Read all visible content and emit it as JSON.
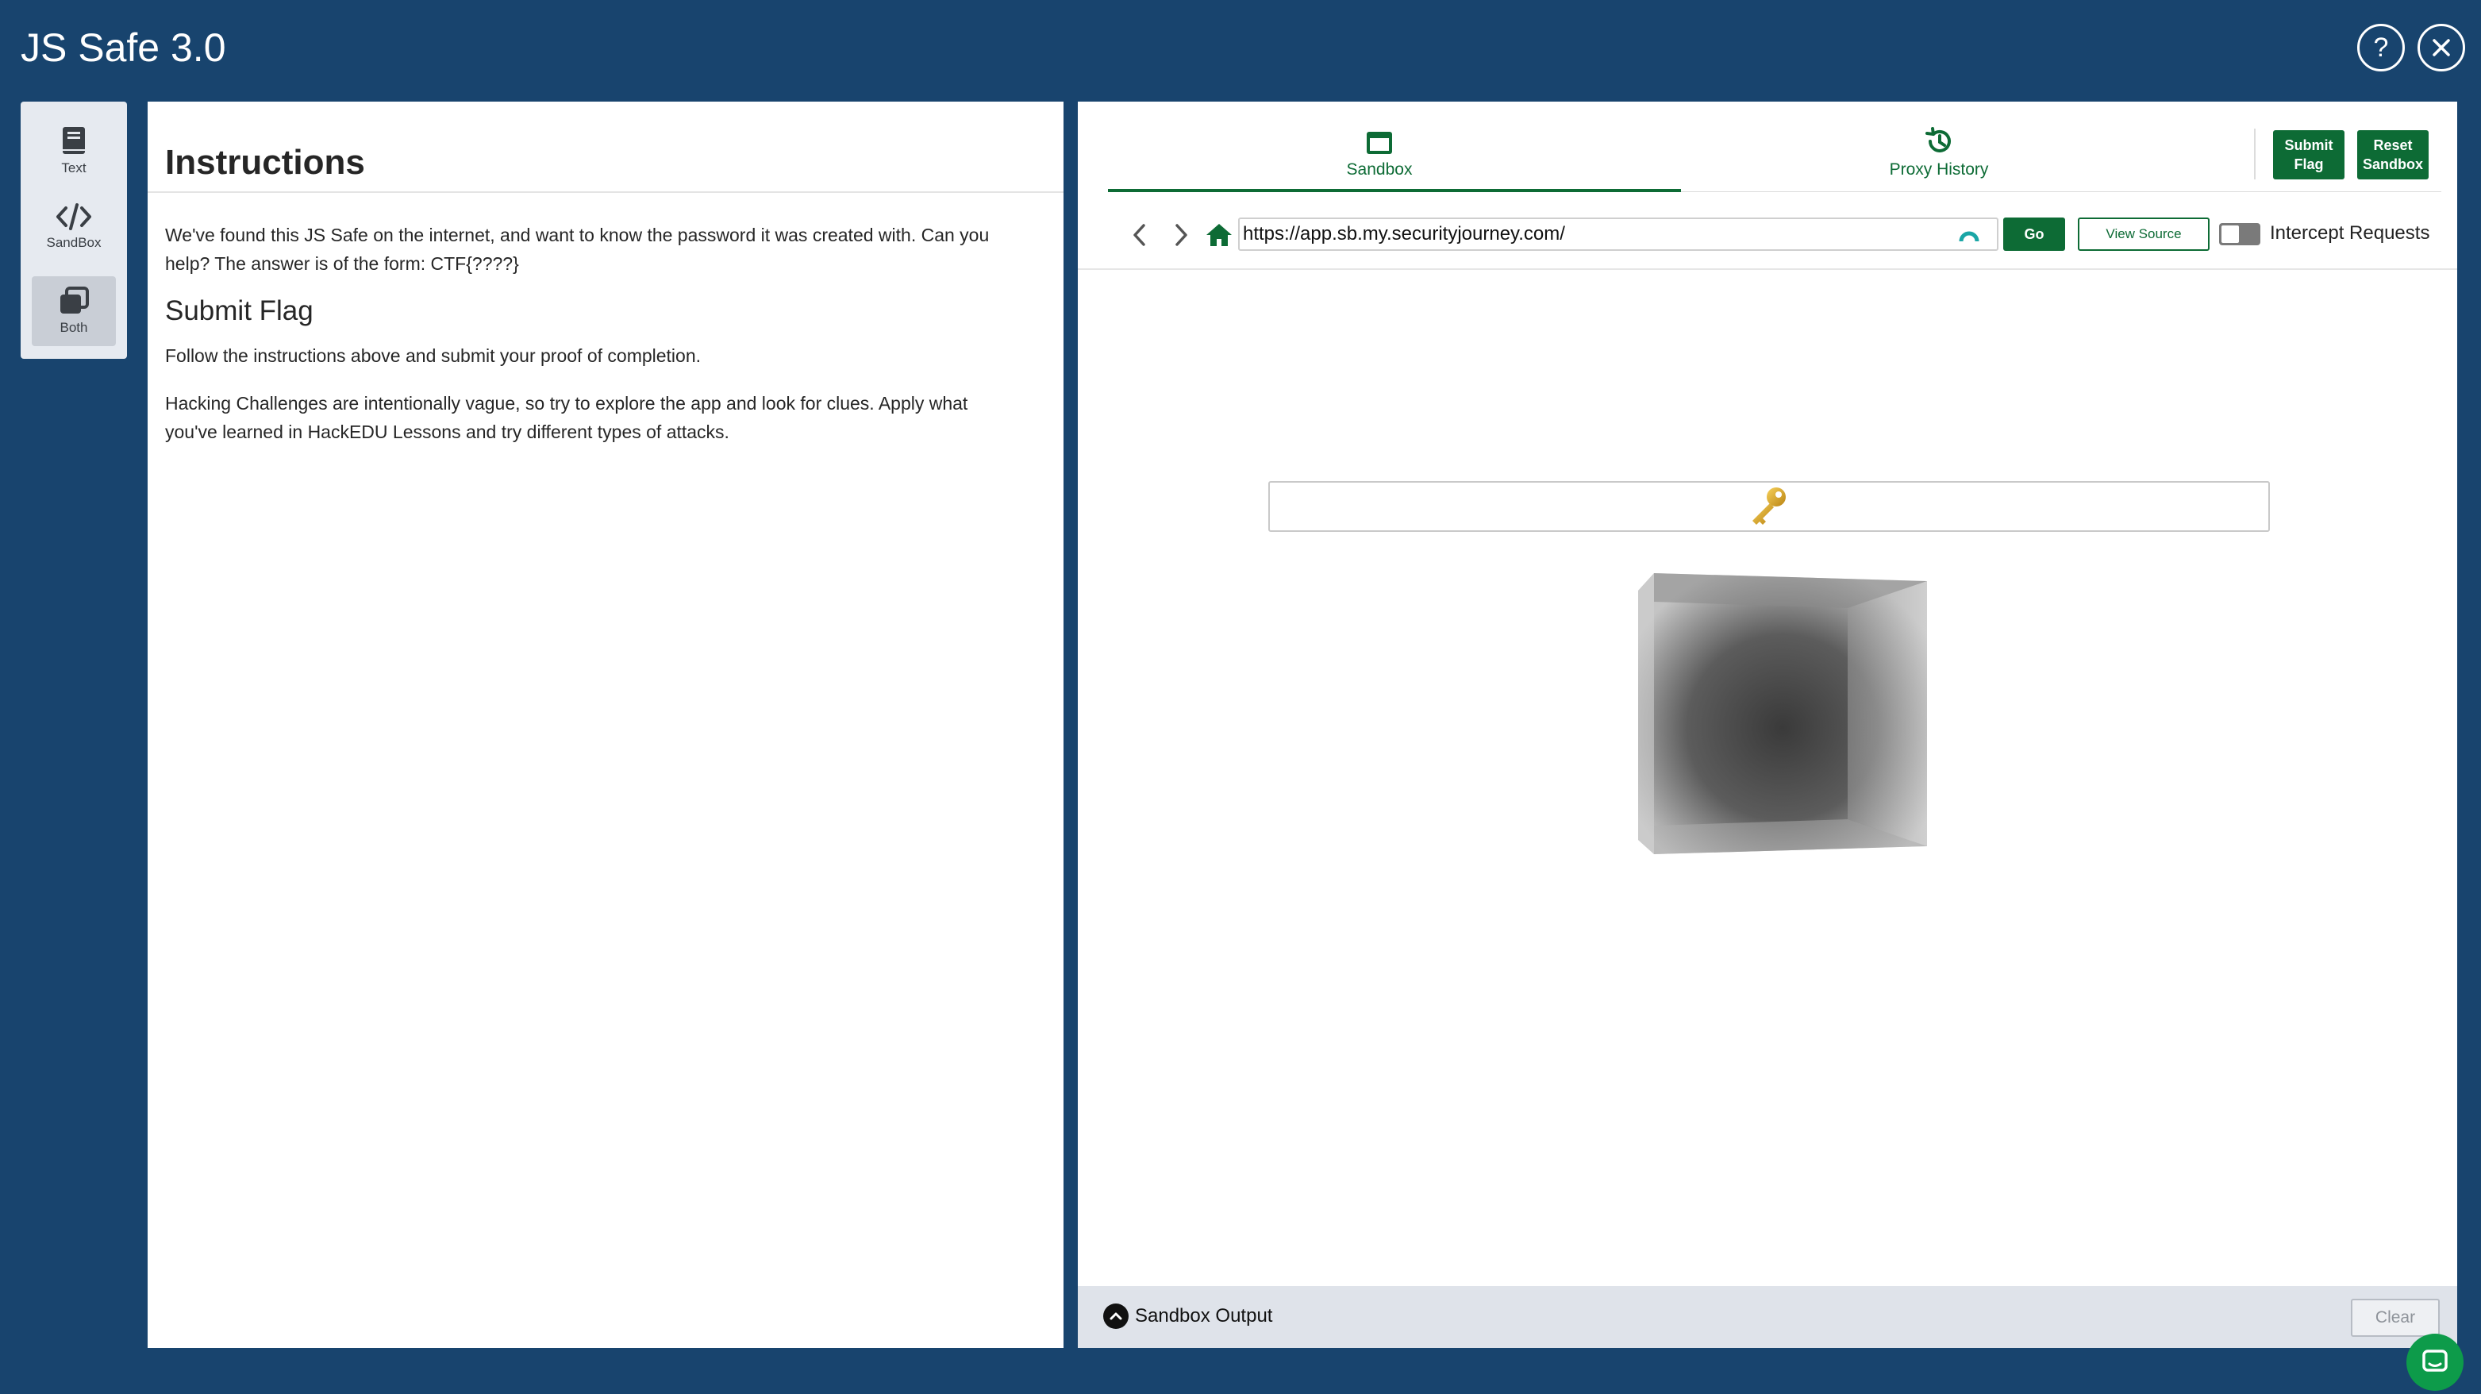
{
  "header": {
    "title": "JS Safe 3.0",
    "help_icon": "question-icon",
    "close_icon": "close-icon"
  },
  "rail": {
    "items": [
      {
        "label": "Text",
        "icon": "book-icon",
        "active": false
      },
      {
        "label": "SandBox",
        "icon": "code-icon",
        "active": false
      },
      {
        "label": "Both",
        "icon": "stack-icon",
        "active": true
      }
    ]
  },
  "instructions": {
    "title": "Instructions",
    "intro": "We've found this JS Safe on the internet, and want to know the password it was created with. Can you help? The answer is of the form: CTF{????}",
    "submit_heading": "Submit Flag",
    "follow_text": "Follow the instructions above and submit your proof of completion.",
    "hint_text": "Hacking Challenges are intentionally vague, so try to explore the app and look for clues. Apply what you've learned in HackEDU Lessons and try different types of attacks."
  },
  "sandbox": {
    "tabs": [
      {
        "label": "Sandbox",
        "icon": "window-icon",
        "active": true
      },
      {
        "label": "Proxy History",
        "icon": "history-icon",
        "active": false
      }
    ],
    "submit_flag_label": "Submit Flag",
    "reset_sandbox_label": "Reset Sandbox",
    "url": "https://app.sb.my.securityjourney.com/",
    "go_label": "Go",
    "view_source_label": "View Source",
    "intercept_label": "Intercept Requests",
    "intercept_enabled": false,
    "output_label": "Sandbox Output",
    "clear_label": "Clear"
  },
  "colors": {
    "background": "#18446e",
    "accent": "#0d6b35",
    "fab": "#0d9b4a"
  }
}
